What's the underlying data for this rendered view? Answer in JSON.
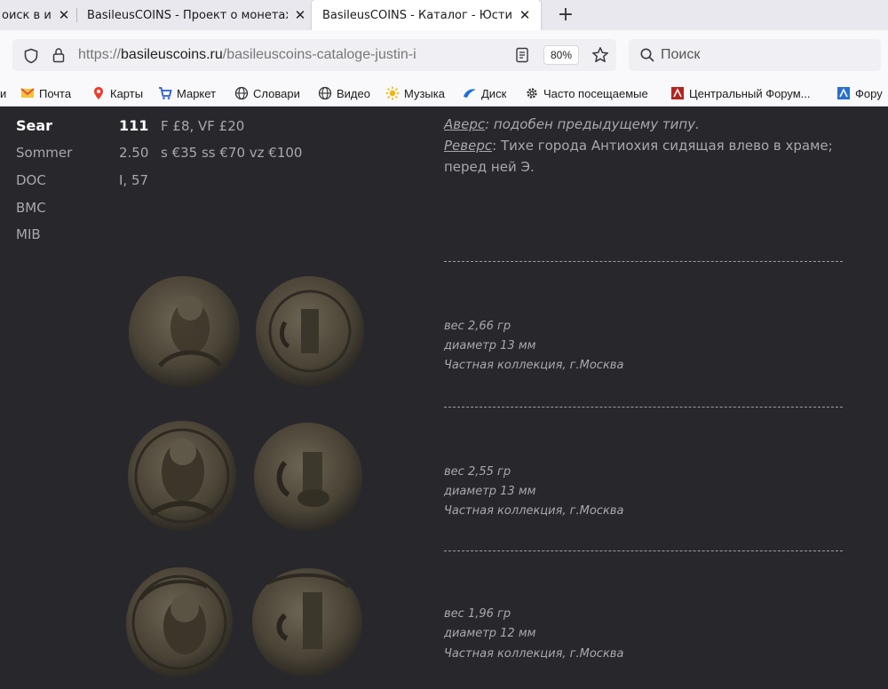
{
  "tabs": [
    {
      "title": "оиск в ин",
      "active": false
    },
    {
      "title": "BasileusCOINS - Проект о монетах",
      "active": false
    },
    {
      "title": "BasileusCOINS - Каталог - Юстин I",
      "active": true
    }
  ],
  "address": {
    "url_prefix": "https://",
    "url_host": "basileuscoins.ru",
    "url_path": "/basileuscoins-cataloge-justin-i",
    "zoom": "80%"
  },
  "search": {
    "placeholder": "Поиск"
  },
  "bookmarks": [
    {
      "label": "и",
      "icon": "truncated"
    },
    {
      "label": "Почта",
      "icon": "mail-icon"
    },
    {
      "label": "Карты",
      "icon": "map-pin-icon"
    },
    {
      "label": "Маркет",
      "icon": "cart-icon"
    },
    {
      "label": "Словари",
      "icon": "globe-icon"
    },
    {
      "label": "Видео",
      "icon": "globe-icon"
    },
    {
      "label": "Музыка",
      "icon": "sun-icon"
    },
    {
      "label": "Диск",
      "icon": "disk-icon"
    },
    {
      "label": "Часто посещаемые",
      "icon": "gear-icon"
    },
    {
      "label": "Центральный Форум...",
      "icon": "forum-icon"
    },
    {
      "label": "Фору",
      "icon": "forum-icon"
    }
  ],
  "references": [
    {
      "name": "Sear",
      "number": "111",
      "price": "F £8, VF £20"
    },
    {
      "name": "Sommer",
      "number": "2.50",
      "price": "s €35 ss €70 vz €100"
    },
    {
      "name": "DOC",
      "number": "I, 57",
      "price": ""
    },
    {
      "name": "BMC",
      "number": "",
      "price": ""
    },
    {
      "name": "MIB",
      "number": "",
      "price": ""
    }
  ],
  "description": {
    "obverse_label": "Аверс",
    "obverse_text": ": подобен предыдущему типу.",
    "reverse_label": "Реверс",
    "reverse_text": ": Тихе города Антиохия сидящая влево в храме; перед ней Э."
  },
  "specimens": [
    {
      "weight": "вес 2,66 гр",
      "diameter": "диаметр 13 мм",
      "collection": "Частная коллекция, г.Москва"
    },
    {
      "weight": "вес 2,55 гр",
      "diameter": "диаметр 13 мм",
      "collection": "Частная коллекция, г.Москва"
    },
    {
      "weight": "вес 1,96 гр",
      "diameter": "диаметр 12 мм",
      "collection": "Частная коллекция, г.Москва"
    }
  ],
  "colors": {
    "page_bg": "#28272c",
    "text": "#a9a8ad",
    "coin_bronze": "#4a4336"
  }
}
